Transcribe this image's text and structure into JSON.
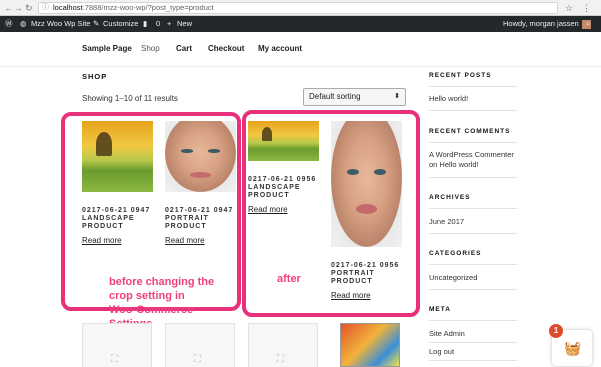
{
  "browser": {
    "url_host": "localhost",
    "url_rest": ":7888/mzz-woo-wp/?post_type=product"
  },
  "adminbar": {
    "site_name": "Mzz Woo Wp Site",
    "customize": "Customize",
    "comments_count": "0",
    "new_label": "New",
    "greeting": "Howdy, morgan jassen"
  },
  "nav": {
    "items": [
      "Sample Page",
      "Shop",
      "Cart",
      "Checkout",
      "My account"
    ]
  },
  "shop": {
    "title": "SHOP",
    "result_count": "Showing 1–10 of 11 results",
    "sort_value": "Default sorting"
  },
  "products": [
    {
      "title": "0217-06-21 0947\nLANDSCAPE\nPRODUCT",
      "link": "Read more"
    },
    {
      "title": "0217-06-21 0947\nPORTRAIT\nPRODUCT",
      "link": "Read more"
    },
    {
      "title": "0217-06-21 0956\nLANDSCAPE\nPRODUCT",
      "link": "Read more"
    },
    {
      "title": "0217-06-21 0956\nPORTRAIT\nPRODUCT",
      "link": "Read more"
    }
  ],
  "annotations": {
    "before": "before changing the\ncrop setting in\nWoo-Commerce\nSettings",
    "after": "after",
    "color": "#e8317a"
  },
  "sidebar": {
    "recent_posts_title": "RECENT POSTS",
    "recent_posts": [
      "Hello world!"
    ],
    "recent_comments_title": "RECENT COMMENTS",
    "recent_comments": [
      "A WordPress Commenter on Hello world!"
    ],
    "archives_title": "ARCHIVES",
    "archives": [
      "June 2017"
    ],
    "categories_title": "CATEGORIES",
    "categories": [
      "Uncategorized"
    ],
    "meta_title": "META",
    "meta": [
      "Site Admin",
      "Log out"
    ]
  },
  "cart": {
    "badge_count": "1"
  }
}
